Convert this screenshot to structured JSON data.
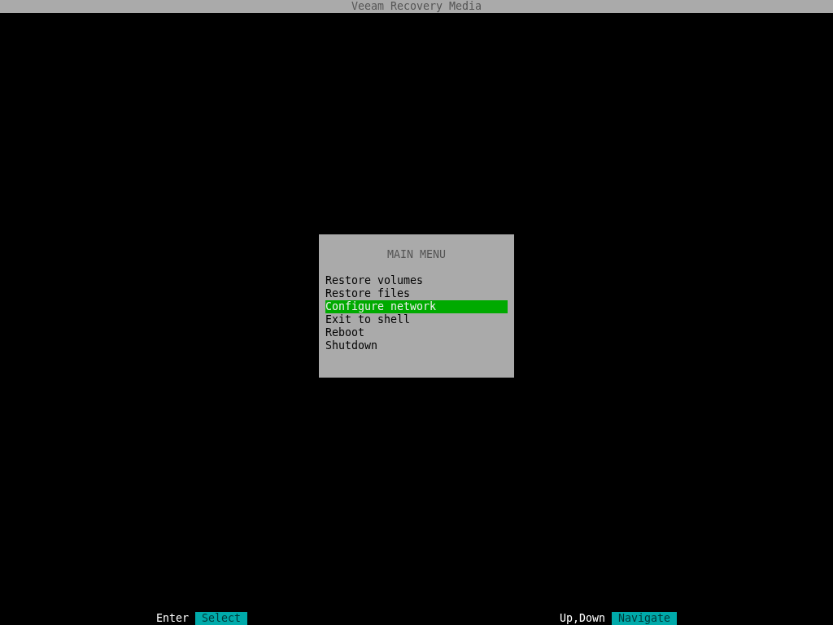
{
  "window": {
    "title": "Veeam Recovery Media"
  },
  "menu": {
    "title": "MAIN MENU",
    "items": [
      {
        "label": "Restore volumes",
        "selected": false
      },
      {
        "label": "Restore files",
        "selected": false
      },
      {
        "label": "Configure network",
        "selected": true
      },
      {
        "label": "Exit to shell",
        "selected": false
      },
      {
        "label": "Reboot",
        "selected": false
      },
      {
        "label": "Shutdown",
        "selected": false
      }
    ]
  },
  "key_hints": [
    {
      "key": "Enter",
      "action": "Select"
    },
    {
      "key": "Up,Down",
      "action": "Navigate"
    }
  ]
}
